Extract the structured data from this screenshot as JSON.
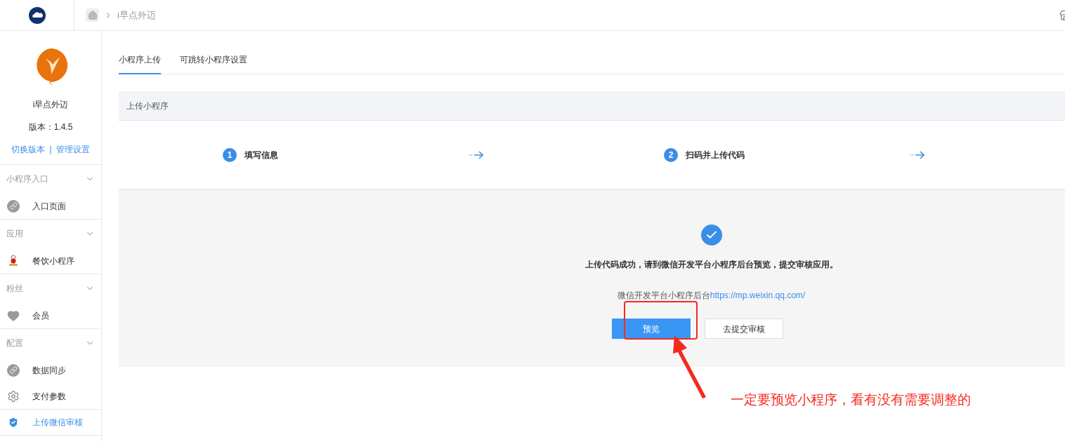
{
  "header": {
    "breadcrumb": "i早点外迈"
  },
  "sidebar": {
    "app_name": "i早点外迈",
    "version": "版本：1.4.5",
    "links": [
      "切换版本",
      "管理设置"
    ],
    "separator": "|",
    "groups": [
      {
        "title": "小程序入口",
        "items": [
          {
            "label": "入口页面",
            "kind": "link",
            "selected": false
          }
        ]
      },
      {
        "title": "应用",
        "items": [
          {
            "label": "餐饮小程序",
            "kind": "person",
            "selected": false
          }
        ]
      },
      {
        "title": "粉丝",
        "items": [
          {
            "label": "会员",
            "kind": "heart",
            "selected": false
          }
        ]
      },
      {
        "title": "配置",
        "items": [
          {
            "label": "数据同步",
            "kind": "link",
            "selected": false
          },
          {
            "label": "支付参数",
            "kind": "gear",
            "selected": false
          },
          {
            "label": "上传微信审核",
            "kind": "shield",
            "selected": true
          }
        ]
      }
    ]
  },
  "tabs": [
    {
      "label": "小程序上传",
      "selected": true
    },
    {
      "label": "可跳转小程序设置",
      "selected": false
    }
  ],
  "panel": {
    "title": "上传小程序",
    "steps": [
      {
        "number": "1",
        "label": "填写信息"
      },
      {
        "number": "2",
        "label": "扫码并上传代码"
      }
    ],
    "result": {
      "message": "上传代码成功，请到微信开发平台小程序后台预览，提交审核应用。",
      "link_prefix": "微信开发平台小程序后台",
      "link": "https://mp.weixin.qq.com/",
      "buttons": [
        {
          "label": "预览",
          "kind": "primary"
        },
        {
          "label": "去提交审核",
          "kind": "default"
        }
      ]
    }
  },
  "annotation": {
    "text": "一定要预览小程序，看有没有需要调整的"
  }
}
